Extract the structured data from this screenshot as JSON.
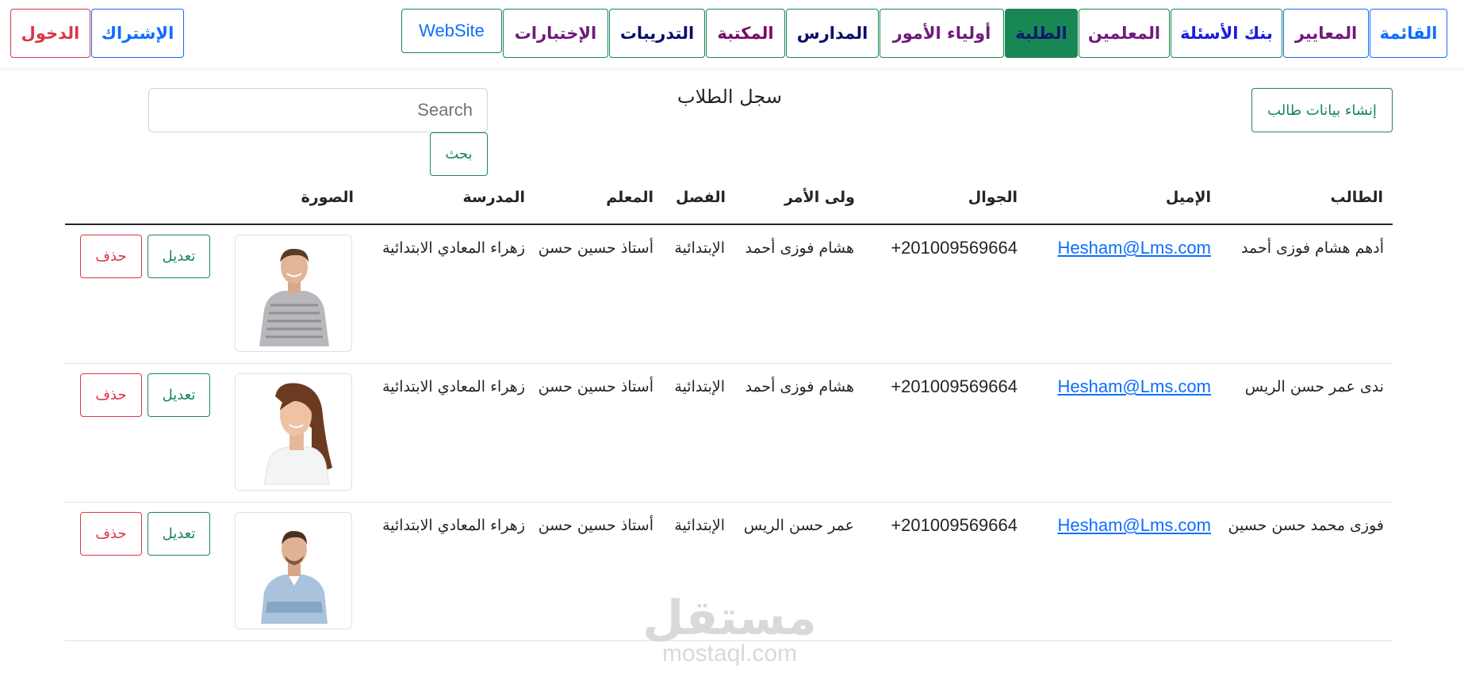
{
  "nav": {
    "items": [
      {
        "label": "القائمة",
        "color": "#0d6efd",
        "border": "#0d6efd"
      },
      {
        "label": "المعايير",
        "color": "#6f1a7a",
        "border": "#0d6efd"
      },
      {
        "label": "بنك الأسئلة",
        "color": "#1a1adf",
        "border": "#198754"
      },
      {
        "label": "المعلمين",
        "color": "#6f1a7a",
        "border": "#198754"
      },
      {
        "label": "الطلبة",
        "color": "#0b1a6b",
        "border": "#198754",
        "active": true
      },
      {
        "label": "أولياء الأمور",
        "color": "#6f1a7a",
        "border": "#198754"
      },
      {
        "label": "المدارس",
        "color": "#0b0b6b",
        "border": "#198754"
      },
      {
        "label": "المكتبة",
        "color": "#7a0a6a",
        "border": "#198754"
      },
      {
        "label": "التدريبات",
        "color": "#0b0b6b",
        "border": "#198754"
      },
      {
        "label": "الإختبارات",
        "color": "#6f1a7a",
        "border": "#198754"
      }
    ],
    "website_label": "WebSite",
    "subscribe_label": "الإشتراك",
    "login_label": "الدخول"
  },
  "colors": {
    "success": "#198754",
    "primary": "#0d6efd",
    "danger": "#dc3545"
  },
  "header": {
    "create_label": "إنشاء بيانات طالب",
    "title": "سجل الطلاب"
  },
  "search": {
    "placeholder": "Search",
    "button_label": "بحث"
  },
  "table": {
    "headers": {
      "student": "الطالب",
      "email": "الإميل",
      "phone": "الجوال",
      "guardian": "ولى الأمر",
      "grade": "الفصل",
      "teacher": "المعلم",
      "school": "المدرسة",
      "photo": "الصورة"
    },
    "edit_label": "تعديل",
    "delete_label": "حذف",
    "rows": [
      {
        "student": "أدهم هشام فوزى أحمد",
        "email": "Hesham@Lms.com",
        "phone": "+201009569664",
        "guardian": "هشام فوزى أحمد",
        "grade": "الإبتدائية",
        "teacher": "أستاذ حسين حسن",
        "school": "زهراء المعادي الابتدائية",
        "photo": "male-student-photo"
      },
      {
        "student": "ندى عمر حسن الريس",
        "email": "Hesham@Lms.com",
        "phone": "+201009569664",
        "guardian": "هشام فوزى أحمد",
        "grade": "الإبتدائية",
        "teacher": "أستاذ حسين حسن",
        "school": "زهراء المعادي الابتدائية",
        "photo": "female-student-photo"
      },
      {
        "student": "فوزى محمد حسن حسين",
        "email": "Hesham@Lms.com",
        "phone": "+201009569664",
        "guardian": "عمر حسن الريس",
        "grade": "الإبتدائية",
        "teacher": "أستاذ حسين حسن",
        "school": "زهراء المعادي الابتدائية",
        "photo": "male-student-photo"
      }
    ]
  },
  "watermark": {
    "logo": "مستقل",
    "url": "mostaql.com"
  }
}
